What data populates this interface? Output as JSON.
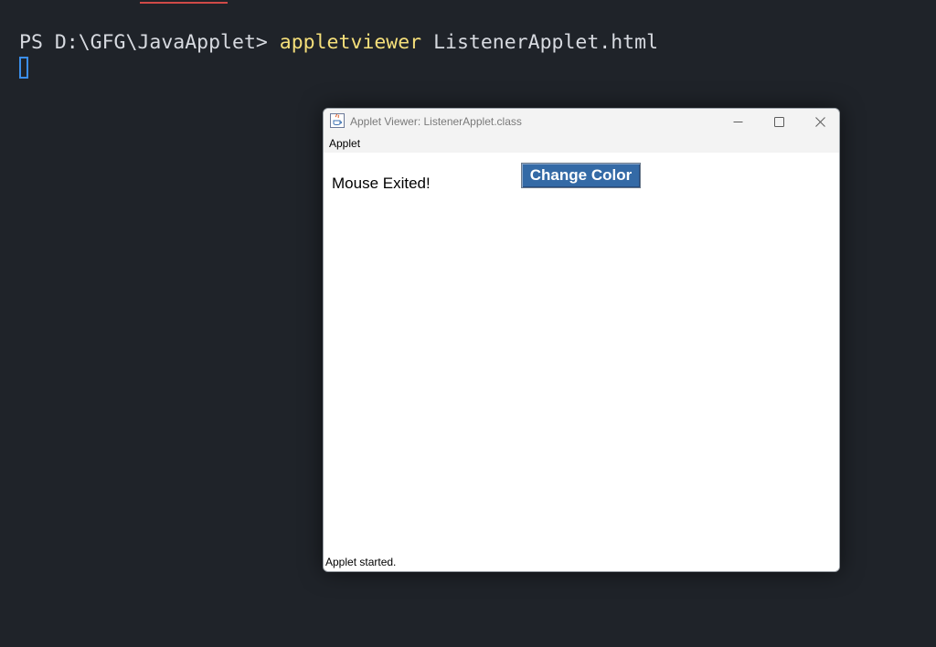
{
  "terminal": {
    "prompt": "PS D:\\GFG\\JavaApplet> ",
    "command": "appletviewer",
    "argument": " ListenerApplet.html"
  },
  "window": {
    "title": "Applet Viewer: ListenerApplet.class",
    "menu": [
      "Applet"
    ],
    "status": "Applet started."
  },
  "applet": {
    "mouse_status": "Mouse Exited!",
    "button_label": "Change Color"
  },
  "colors": {
    "terminal_bg": "#1f2329",
    "command_highlight": "#f5df7a",
    "cursor": "#3b8eea",
    "button_bg": "#346aa6"
  },
  "icons": [
    "java-applet-icon",
    "minimize-icon",
    "maximize-icon",
    "close-icon"
  ]
}
